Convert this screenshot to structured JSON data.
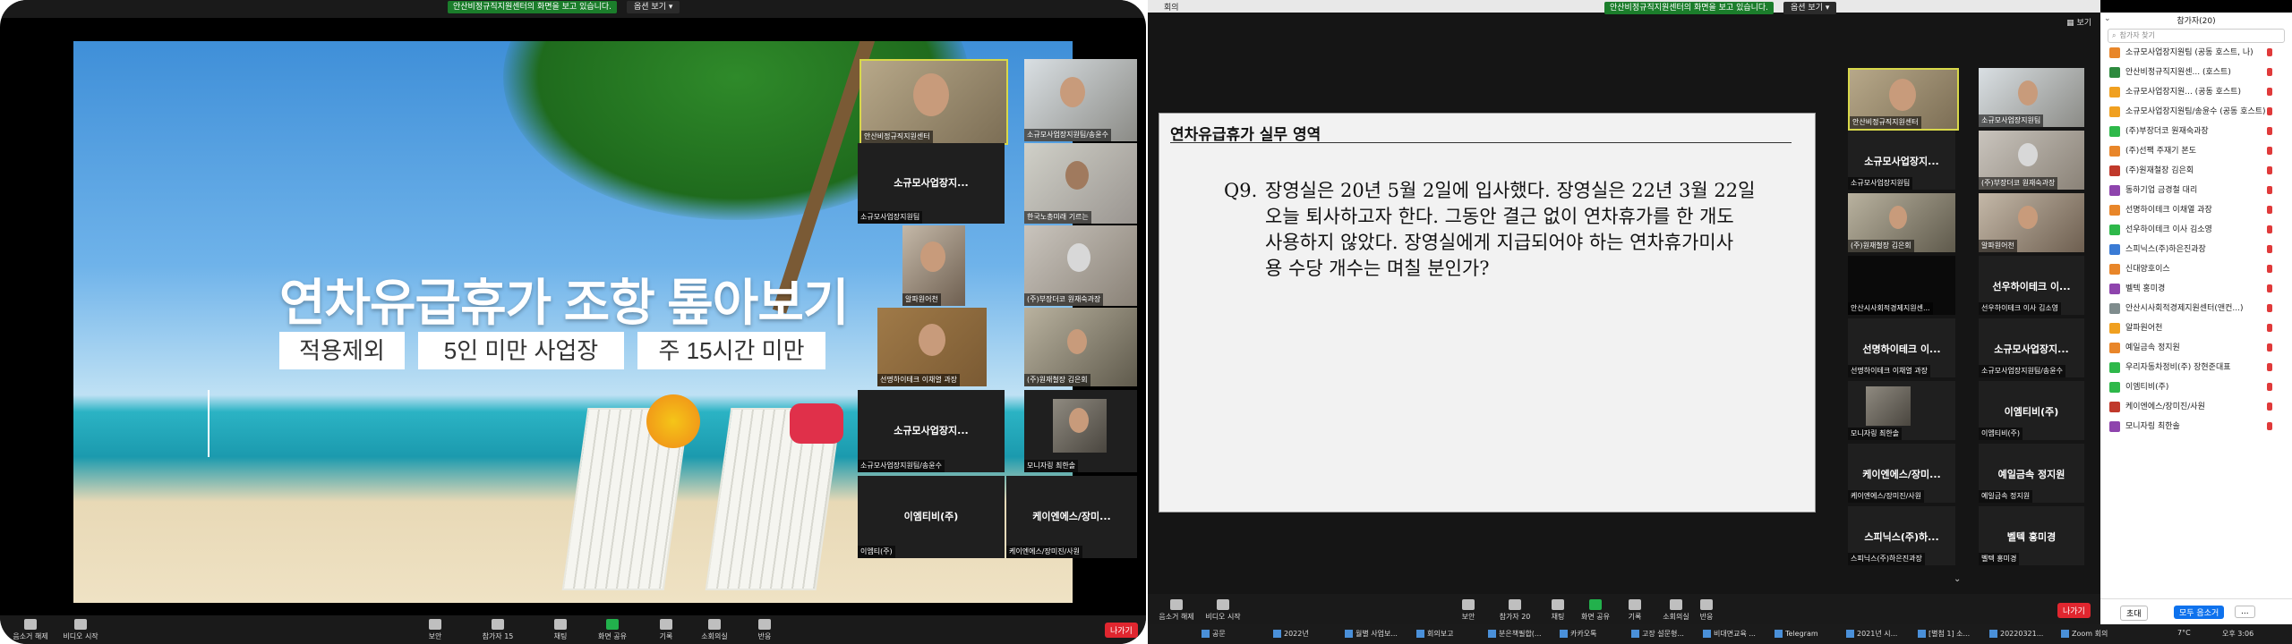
{
  "share_banner": "안산비정규직지원센터의 화면을 보고 있습니다.",
  "view_options": "옵션 보기",
  "slide": {
    "title": "연차유급휴가 조항 톺아보기",
    "chips": [
      "적용제외",
      "5인 미만 사업장",
      "주 15시간 미만"
    ]
  },
  "left_tiles": [
    {
      "name": "안산비정규직지원센터",
      "big": ""
    },
    {
      "name": "소규모사업장지원팀/송윤수",
      "big": ""
    },
    {
      "name": "소규모사업장지원팀",
      "big": "소규모사업장지..."
    },
    {
      "name": "한국노총미래 기르는",
      "big": ""
    },
    {
      "name": "알파원어천",
      "big": ""
    },
    {
      "name": "(주)부장더코 원재숙과장",
      "big": ""
    },
    {
      "name": "선명하이테크 이채열 과장",
      "big": ""
    },
    {
      "name": "(주)원재철장 김은회",
      "big": ""
    },
    {
      "name": "소규모사업장지원팀/송윤수",
      "big": "소규모사업장지..."
    },
    {
      "name": "모니자링 최한솔",
      "big": ""
    },
    {
      "name": "이엠티(주)",
      "big": "이엠티비(주)"
    },
    {
      "name": "케이엔에스/장미진/사원",
      "big": "케이엔에스/장미..."
    }
  ],
  "toolbar_left": {
    "mute": "음소거 해제",
    "video": "비디오 시작",
    "security": "보안",
    "participants": "참가자",
    "participants_count": "15",
    "chat": "채팅",
    "share": "화면 공유",
    "record": "기록",
    "breakout": "소회의실",
    "reactions": "반응",
    "leave": "나가기"
  },
  "toolbar_right": {
    "mute": "음소거 해제",
    "video": "비디오 시작",
    "security": "보안",
    "participants": "참가자",
    "participants_count": "20",
    "chat": "채팅",
    "share": "화면 공유",
    "record": "기록",
    "breakout": "소회의실",
    "reactions": "반응",
    "leave": "나가기"
  },
  "right_window_title": "회의",
  "view_label": "보기",
  "doc": {
    "title": "연차유급휴가 실무 영역",
    "question_no": "Q9.",
    "question_lines": [
      "장영실은 20년 5월 2일에 입사했다. 장영실은 22년 3월 22일",
      "오늘 퇴사하고자 한다. 그동안 결근 없이 연차휴가를 한 개도",
      "사용하지 않았다. 장영실에게 지급되어야 하는 연차휴가미사",
      "용 수당 개수는 며칠 분인가?"
    ]
  },
  "right_tiles": [
    {
      "name": "안산비정규직지원센터",
      "big": ""
    },
    {
      "name": "소규모사업장지원팀",
      "big": ""
    },
    {
      "name": "소규모사업장지원팀",
      "big": "소규모사업장지..."
    },
    {
      "name": "(주)부장더코 원재숙과장",
      "big": ""
    },
    {
      "name": "(주)원재철장 김은회",
      "big": ""
    },
    {
      "name": "알파원어천",
      "big": ""
    },
    {
      "name": "안산시사회적경제지원센...",
      "big": ""
    },
    {
      "name": "선우하이테크 이사 김소영",
      "big": "선우하이테크 이..."
    },
    {
      "name": "선명하이테크 이채열 과장",
      "big": "선명하이테크 이..."
    },
    {
      "name": "소규모사업장지원팀/송윤수",
      "big": "소규모사업장지..."
    },
    {
      "name": "모니자링 최한솔",
      "big": ""
    },
    {
      "name": "이엠티비(주)",
      "big": "이엠티비(주)"
    },
    {
      "name": "케이엔에스/장미진/사원",
      "big": "케이엔에스/장미..."
    },
    {
      "name": "예일금속 정지원",
      "big": "예일금속 정지원"
    },
    {
      "name": "스피닉스(주)하은진과장",
      "big": "스피닉스(주)하..."
    },
    {
      "name": "벨텍 홍미경",
      "big": "벨텍 홍미경"
    }
  ],
  "participants_panel": {
    "title": "참가자(20)",
    "search_placeholder": "참가자 찾기",
    "items": [
      {
        "name": "소규모사업장지원팀 (공동 호스트, 나)",
        "color": "#e8862a"
      },
      {
        "name": "안산비정규직지원센... (호스트)",
        "color": "#2d8a3e"
      },
      {
        "name": "소규모사업장지원... (공동 호스트)",
        "color": "#f0a020"
      },
      {
        "name": "소규모사업장지원팀/송윤수 (공동 호스트)",
        "color": "#f0a020"
      },
      {
        "name": "(주)부장더코 원재숙과장",
        "color": "#2eb84a"
      },
      {
        "name": "(주)선팩 주재기 본도",
        "color": "#e8862a"
      },
      {
        "name": "(주)원재철장 김은회",
        "color": "#c0392b"
      },
      {
        "name": "동하기업 금경철 대리",
        "color": "#8e44ad"
      },
      {
        "name": "선명하이테크 이채열 과장",
        "color": "#e8862a"
      },
      {
        "name": "선우하이테크 이사 김소영",
        "color": "#2eb84a"
      },
      {
        "name": "스피닉스(주)하은진과장",
        "color": "#3a7bd5"
      },
      {
        "name": "신대양호이스",
        "color": "#e8862a"
      },
      {
        "name": "벨텍 홍미경",
        "color": "#8e44ad"
      },
      {
        "name": "안산시사회적경제지원센터(앤컨...)",
        "color": "#7f8c8d"
      },
      {
        "name": "알파원어천",
        "color": "#f0a020"
      },
      {
        "name": "예일금속 정지원",
        "color": "#e8862a"
      },
      {
        "name": "우리자동차정비(주) 장현준대표",
        "color": "#2eb84a"
      },
      {
        "name": "이엠티비(주)",
        "color": "#2eb84a"
      },
      {
        "name": "케이엔에스/장미진/사원",
        "color": "#c0392b"
      },
      {
        "name": "모니자링 최한솔",
        "color": "#8e44ad"
      }
    ],
    "invite": "초대",
    "mute_all": "모두 음소거",
    "more": "..."
  },
  "taskbar": {
    "items": [
      "공문",
      "2022년",
      "월별 사업보...",
      "회의보고",
      "분은책필합(...",
      "카카오톡",
      "고장 설문형...",
      "비대면교육 ...",
      "Telegram",
      "2021년 시...",
      "[별첨 1] 소...",
      "20220321...",
      "Zoom 회의"
    ],
    "weather": "7°C",
    "time": "오후 3:06"
  }
}
